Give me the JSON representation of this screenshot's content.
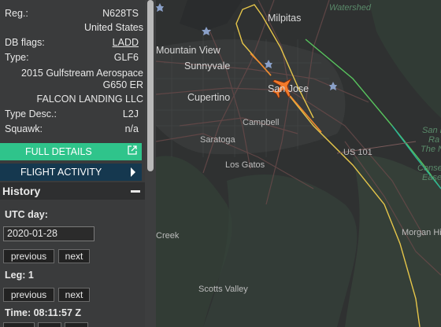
{
  "aircraft": {
    "reg_label": "Reg.:",
    "reg_value": "N628TS",
    "country": "United States",
    "db_flags_label": "DB flags:",
    "db_flags_value": "LADD",
    "type_label": "Type:",
    "type_value": "GLF6",
    "model_line1": "2015 Gulfstream Aerospace",
    "model_line2": "G650 ER",
    "owner": "FALCON LANDING LLC",
    "type_desc_label": "Type Desc.:",
    "type_desc_value": "L2J",
    "squawk_label": "Squawk:",
    "squawk_value": "n/a"
  },
  "buttons": {
    "full_details": "FULL DETAILS",
    "flight_activity": "FLIGHT ACTIVITY"
  },
  "history": {
    "title": "History",
    "utc_day_label": "UTC day:",
    "utc_day_value": "2020-01-28",
    "previous_label": "previous",
    "next_label": "next",
    "leg_label": "Leg: 1",
    "time_label": "Time: 08:11:57 Z"
  },
  "map": {
    "places": [
      {
        "name": "Milpitas"
      },
      {
        "name": "Mountain View"
      },
      {
        "name": "Sunnyvale"
      },
      {
        "name": "San Jose"
      },
      {
        "name": "Cupertino"
      },
      {
        "name": "Campbell"
      },
      {
        "name": "Saratoga"
      },
      {
        "name": "Los Gatos"
      },
      {
        "name": "US 101"
      },
      {
        "name": "Morgan Hi"
      },
      {
        "name": "Scotts Valley"
      },
      {
        "name": "Creek"
      },
      {
        "name": "Watershed"
      },
      {
        "name": "San F"
      },
      {
        "name": "Ra"
      },
      {
        "name": "The N"
      },
      {
        "name": "Conser"
      },
      {
        "name": "Easem"
      }
    ],
    "colors": {
      "track_orange": "#f28a2e",
      "track_yellow": "#e6c64a",
      "track_green": "#58c45e",
      "track_teal": "#2bb59a",
      "aircraft": "#f47a2a"
    }
  },
  "colors": {
    "sidebar_bg": "#3a3b3c",
    "full_details_bg": "#2fc48b",
    "flight_activity_bg": "#15384f"
  }
}
